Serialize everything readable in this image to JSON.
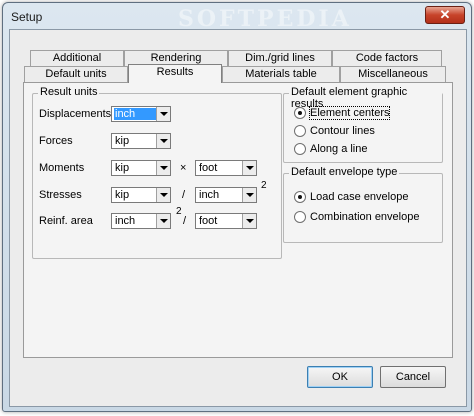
{
  "window": {
    "title": "Setup",
    "watermark": "SOFTPEDIA",
    "close_glyph": "✕"
  },
  "tabs_row1": [
    "Additional",
    "Rendering",
    "Dim./grid lines",
    "Code factors"
  ],
  "tabs_row2": [
    "Default units",
    "Results",
    "Materials table",
    "Miscellaneous"
  ],
  "active_tab": "Results",
  "result_units": {
    "title": "Result units",
    "displacements": {
      "label": "Displacements",
      "value": "inch"
    },
    "forces": {
      "label": "Forces",
      "value": "kip"
    },
    "moments": {
      "label": "Moments",
      "value1": "kip",
      "operator": "×",
      "value2": "foot"
    },
    "stresses": {
      "label": "Stresses",
      "value1": "kip",
      "operator": "/",
      "value2": "inch",
      "exponent": "2"
    },
    "reinf_area": {
      "label": "Reinf. area",
      "value1": "inch",
      "exponent": "2",
      "operator": "/",
      "value2": "foot"
    }
  },
  "graphic_results": {
    "title": "Default element graphic results",
    "options": [
      "Element centers",
      "Contour lines",
      "Along a line"
    ],
    "selected": "Element centers"
  },
  "envelope_type": {
    "title": "Default envelope type",
    "options": [
      "Load case envelope",
      "Combination envelope"
    ],
    "selected": "Load case envelope"
  },
  "buttons": {
    "ok": "OK",
    "cancel": "Cancel"
  }
}
